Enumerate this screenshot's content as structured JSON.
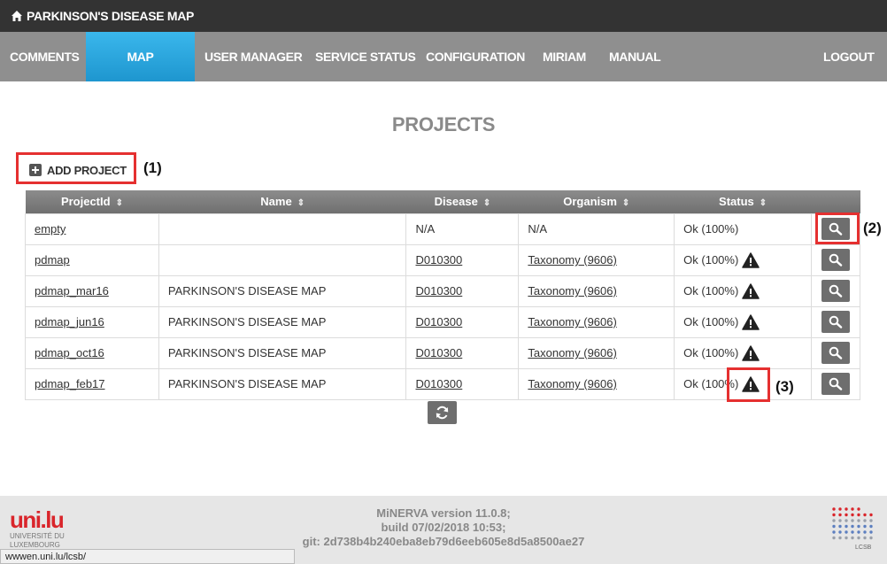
{
  "app": {
    "title": "PARKINSON'S DISEASE MAP",
    "home_icon": "home-icon"
  },
  "nav": {
    "items": [
      {
        "label": "COMMENTS",
        "active": false
      },
      {
        "label": "MAP MANAGER",
        "active": true
      },
      {
        "label": "USER MANAGER",
        "active": false
      },
      {
        "label": "SERVICE STATUS",
        "active": false
      },
      {
        "label": "CONFIGURATION",
        "active": false
      },
      {
        "label": "MIRIAM",
        "active": false
      },
      {
        "label": "MANUAL",
        "active": false
      }
    ],
    "logout": "LOGOUT",
    "active_color": "#2aa7de",
    "bar_color": "#8f8f8f"
  },
  "page": {
    "title": "PROJECTS",
    "add_project": "ADD PROJECT"
  },
  "callouts": {
    "one": "(1)",
    "two": "(2)",
    "three": "(3)",
    "color": "#e53030"
  },
  "table": {
    "headers": [
      "ProjectId",
      "Name",
      "Disease",
      "Organism",
      "Status"
    ],
    "sort_icon": "sort-icon",
    "rows": [
      {
        "id": "empty",
        "name": "",
        "disease": "N/A",
        "disease_link": false,
        "organism": "N/A",
        "organism_link": false,
        "status": "Ok (100%)",
        "warning": false
      },
      {
        "id": "pdmap",
        "name": "",
        "disease": "D010300",
        "disease_link": true,
        "organism": "Taxonomy (9606)",
        "organism_link": true,
        "status": "Ok (100%)",
        "warning": true
      },
      {
        "id": "pdmap_mar16",
        "name": "PARKINSON'S DISEASE MAP",
        "disease": "D010300",
        "disease_link": true,
        "organism": "Taxonomy (9606)",
        "organism_link": true,
        "status": "Ok (100%)",
        "warning": true
      },
      {
        "id": "pdmap_jun16",
        "name": "PARKINSON'S DISEASE MAP",
        "disease": "D010300",
        "disease_link": true,
        "organism": "Taxonomy (9606)",
        "organism_link": true,
        "status": "Ok (100%)",
        "warning": true
      },
      {
        "id": "pdmap_oct16",
        "name": "PARKINSON'S DISEASE MAP",
        "disease": "D010300",
        "disease_link": true,
        "organism": "Taxonomy (9606)",
        "organism_link": true,
        "status": "Ok (100%)",
        "warning": true
      },
      {
        "id": "pdmap_feb17",
        "name": "PARKINSON'S DISEASE MAP",
        "disease": "D010300",
        "disease_link": true,
        "organism": "Taxonomy (9606)",
        "organism_link": true,
        "status": "Ok (100%)",
        "warning": true
      }
    ]
  },
  "footer": {
    "version": "MiNERVA version 11.0.8;",
    "build": "build 07/02/2018 10:53;",
    "git": "git: 2d738b4b240eba8eb79d6eeb605e8d5a8500ae27",
    "uni_logo": "uni.lu",
    "uni_sub1": "UNIVERSITÉ DU",
    "uni_sub2": "LUXEMBOURG",
    "lcsb_label": "LCSB"
  },
  "status_bar": {
    "url": "wwwen.uni.lu/lcsb/"
  }
}
